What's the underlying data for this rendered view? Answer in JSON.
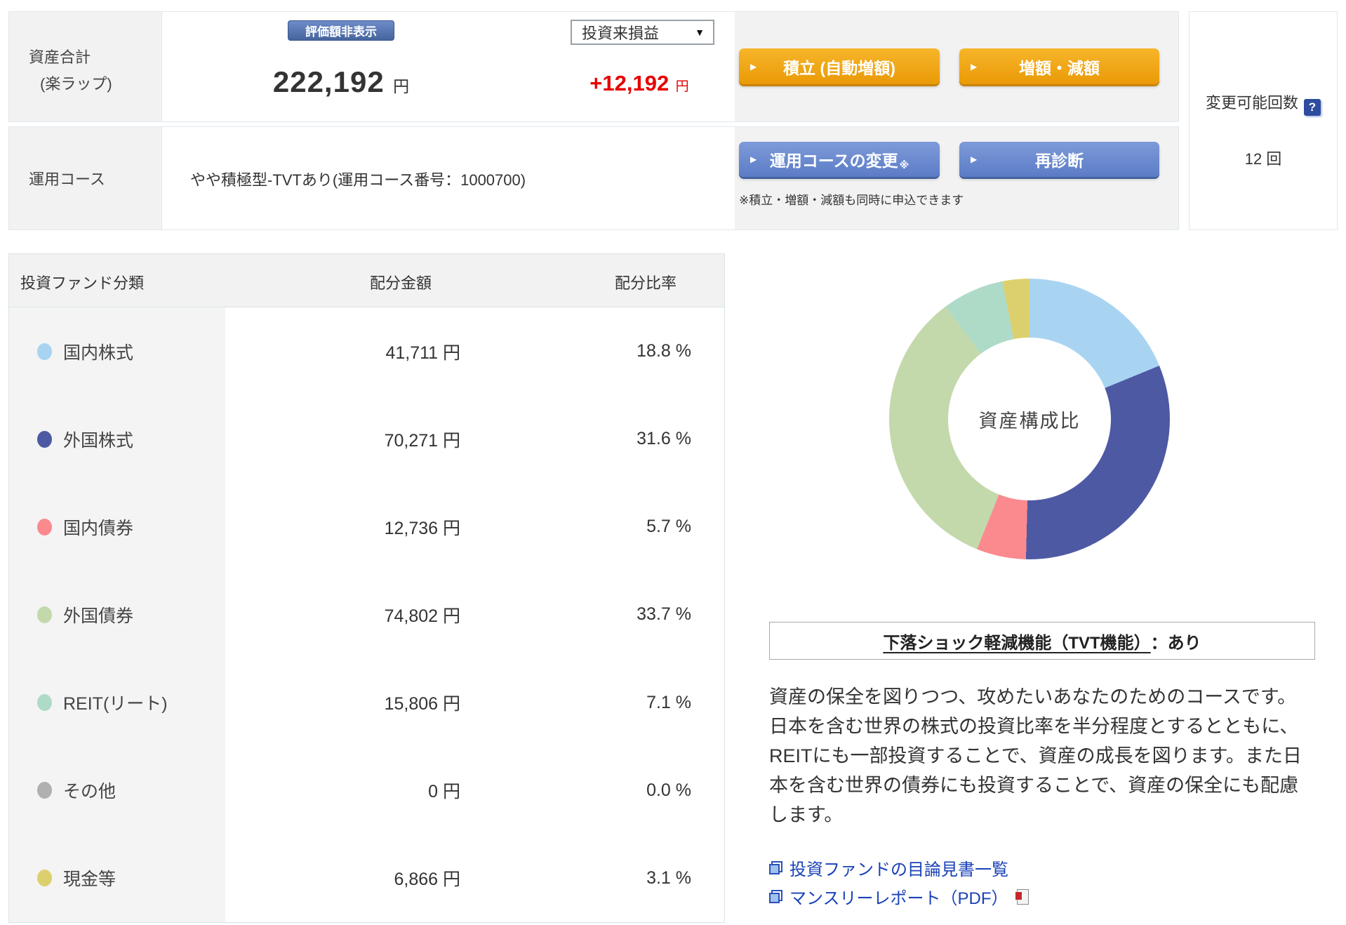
{
  "top": {
    "asset_label_line1": "資産合計",
    "asset_label_line2": "(楽ラップ)",
    "hide_value_button": "評価額非表示",
    "total_amount": "222,192",
    "total_unit": "円",
    "profit_select": "投資来損益",
    "profit_select_caret": "▼",
    "profit_amount": "+12,192",
    "profit_unit": "円",
    "profit_color": "#e60000",
    "reserve_button": "積立 (自動増額)",
    "amount_change_button": "増額・減額",
    "button_arrow": "▶",
    "course_label": "運用コース",
    "course_value": "やや積極型-TVTあり(運用コース番号：1000700)",
    "course_change_button": "運用コースの変更",
    "course_change_mark": "※",
    "rediagnose_button": "再診断",
    "simultaneous_note": "※積立・増額・減額も同時に申込できます",
    "change_count_label": "変更可能回数",
    "help_icon_glyph": "?",
    "change_count_value": "12 回"
  },
  "allocation_table": {
    "col_category": "投資ファンド分類",
    "col_amount": "配分金額",
    "col_ratio": "配分比率",
    "rows": [
      {
        "label": "国内株式",
        "color": "#a8d4f2",
        "amount": "41,711 円",
        "ratio": "18.8 %"
      },
      {
        "label": "外国株式",
        "color": "#4e59a3",
        "amount": "70,271 円",
        "ratio": "31.6 %"
      },
      {
        "label": "国内債券",
        "color": "#fa8a8e",
        "amount": "12,736 円",
        "ratio": "5.7 %"
      },
      {
        "label": "外国債券",
        "color": "#c4d9ab",
        "amount": "74,802 円",
        "ratio": "33.7 %"
      },
      {
        "label": "REIT(リート)",
        "color": "#aedbc8",
        "amount": "15,806 円",
        "ratio": "7.1 %"
      },
      {
        "label": "その他",
        "color": "#b0b0b0",
        "amount": "0 円",
        "ratio": "0.0 %"
      },
      {
        "label": "現金等",
        "color": "#dcd06e",
        "amount": "6,866 円",
        "ratio": "3.1 %"
      }
    ]
  },
  "chart_data": {
    "type": "pie",
    "donut": true,
    "center_label": "資産構成比",
    "categories": [
      "国内株式",
      "外国株式",
      "国内債券",
      "外国債券",
      "REIT(リート)",
      "その他",
      "現金等"
    ],
    "values": [
      18.8,
      31.6,
      5.7,
      33.7,
      7.1,
      0.0,
      3.1
    ],
    "amounts_yen": [
      41711,
      70271,
      12736,
      74802,
      15806,
      0,
      6866
    ],
    "colors": [
      "#a8d4f2",
      "#4e59a3",
      "#fa8a8e",
      "#c4d9ab",
      "#aedbc8",
      "#b0b0b0",
      "#dcd06e"
    ],
    "start_angle_deg": 0,
    "legend_position": "table-left"
  },
  "tvt_box": {
    "heading_underlined": "下落ショック軽減機能（TVT機能）",
    "heading_rest": "：あり",
    "description": "資産の保全を図りつつ、攻めたいあなたのためのコースです。日本を含む世界の株式の投資比率を半分程度とするとともに、REITにも一部投資することで、資産の成長を図ります。また日本を含む世界の債券にも投資することで、資産の保全にも配慮します。"
  },
  "links": [
    {
      "label": "投資ファンドの目論見書一覧"
    },
    {
      "label": "マンスリーレポート（PDF）",
      "pdf_icon": true
    }
  ]
}
